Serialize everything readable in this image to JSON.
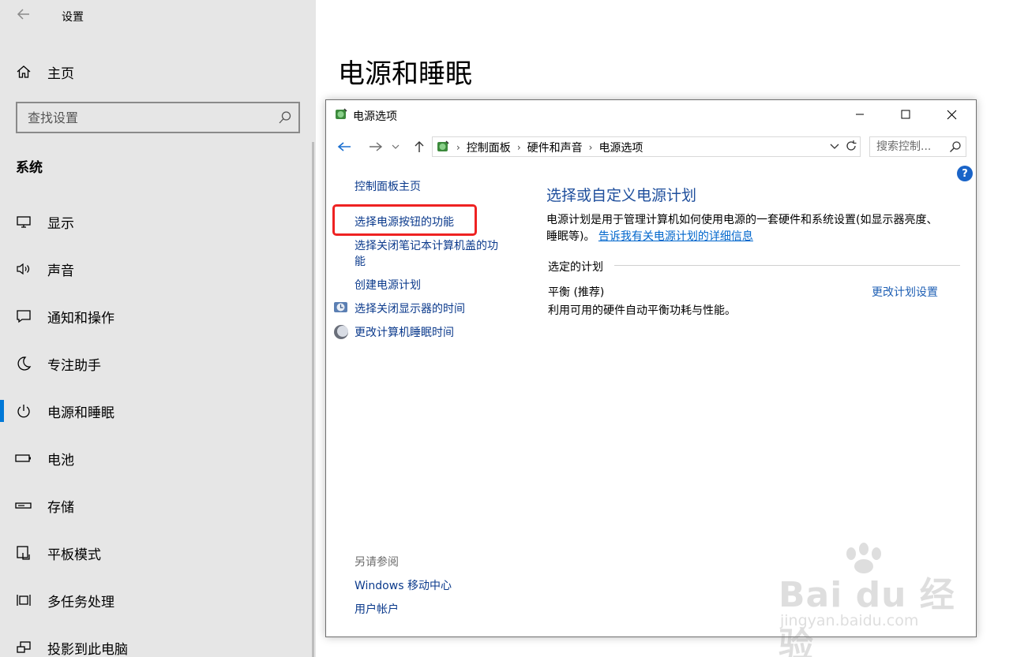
{
  "settings": {
    "app_title": "设置",
    "home_label": "主页",
    "search_placeholder": "查找设置",
    "section_title": "系统",
    "nav": [
      {
        "label": "显示",
        "icon": "monitor-icon"
      },
      {
        "label": "声音",
        "icon": "speaker-icon"
      },
      {
        "label": "通知和操作",
        "icon": "notification-icon"
      },
      {
        "label": "专注助手",
        "icon": "moon-icon"
      },
      {
        "label": "电源和睡眠",
        "icon": "power-icon",
        "active": true
      },
      {
        "label": "电池",
        "icon": "battery-icon"
      },
      {
        "label": "存储",
        "icon": "storage-icon"
      },
      {
        "label": "平板模式",
        "icon": "tablet-icon"
      },
      {
        "label": "多任务处理",
        "icon": "multitask-icon"
      },
      {
        "label": "投影到此电脑",
        "icon": "project-icon"
      }
    ]
  },
  "page": {
    "heading": "电源和睡眠"
  },
  "window": {
    "title": "电源选项",
    "breadcrumb": [
      "控制面板",
      "硬件和声音",
      "电源选项"
    ],
    "search_placeholder": "搜索控制...",
    "help": "?",
    "left_tasks": {
      "home": "控制面板主页",
      "power_button": "选择电源按钮的功能",
      "lid_line1": "选择关闭笔记本计算机盖的功",
      "lid_line2": "能",
      "create_plan": "创建电源计划",
      "display_off": "选择关闭显示器的时间",
      "sleep_time": "更改计算机睡眠时间"
    },
    "see_also": {
      "heading": "另请参阅",
      "mobility_center": "Windows 移动中心",
      "user_accounts": "用户帐户"
    },
    "main": {
      "title": "选择或自定义电源计划",
      "desc_line1": "电源计划是用于管理计算机如何使用电源的一套硬件和系统设置(如显示器亮度、",
      "desc_line2": "睡眠等)。",
      "desc_link": "告诉我有关电源计划的详细信息",
      "selected_plan_label": "选定的计划",
      "plan_name": "平衡 (推荐)",
      "plan_link": "更改计划设置",
      "plan_desc": "利用可用的硬件自动平衡功耗与性能。"
    }
  },
  "watermark": {
    "main": "Bai du 经验",
    "sub": "jingyan.baidu.com"
  },
  "colors": {
    "accent": "#0078d7",
    "link": "#0b3a8c",
    "title_blue": "#1e4e9c",
    "highlight": "#ee2222"
  }
}
